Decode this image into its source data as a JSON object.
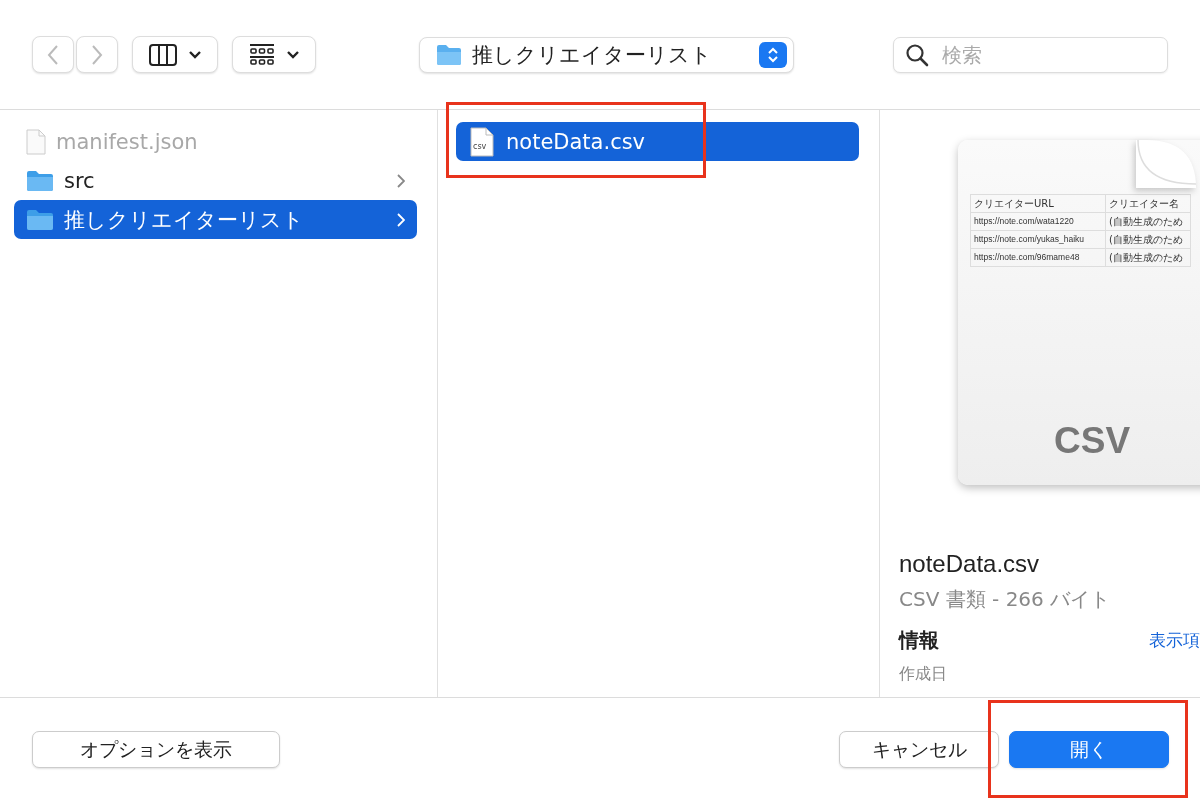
{
  "toolbar": {
    "back_disabled": true,
    "forward_disabled": true,
    "path": "推しクリエイターリスト",
    "search": {
      "placeholder": "検索"
    }
  },
  "sidebar": {
    "items": [
      {
        "name": "manifest.json",
        "kind": "file",
        "disabled": true,
        "selected": false,
        "has_children": false
      },
      {
        "name": "src",
        "kind": "folder",
        "disabled": false,
        "selected": false,
        "has_children": true
      },
      {
        "name": "推しクリエイターリスト",
        "kind": "folder",
        "disabled": false,
        "selected": true,
        "has_children": true
      }
    ]
  },
  "files": [
    {
      "name": "noteData.csv",
      "icon_label": "csv",
      "selected": true,
      "highlighted": true
    }
  ],
  "preview": {
    "doc_label": "CSV",
    "table": [
      [
        "クリエイターURL",
        "クリエイター名"
      ],
      [
        "https://note.com/wata1220",
        "(自動生成のため"
      ],
      [
        "https://note.com/yukas_haiku",
        "(自動生成のため"
      ],
      [
        "https://note.com/96mame48",
        "(自動生成のため"
      ]
    ],
    "name": "noteData.csv",
    "kind_size": "CSV 書類 - 266 バイト",
    "info_heading": "情報",
    "info_link": "表示項",
    "created_label": "作成日"
  },
  "footer": {
    "options_button": "オプションを表示",
    "cancel_button": "キャンセル",
    "open_button": {
      "label": "開く",
      "highlighted": true
    }
  }
}
